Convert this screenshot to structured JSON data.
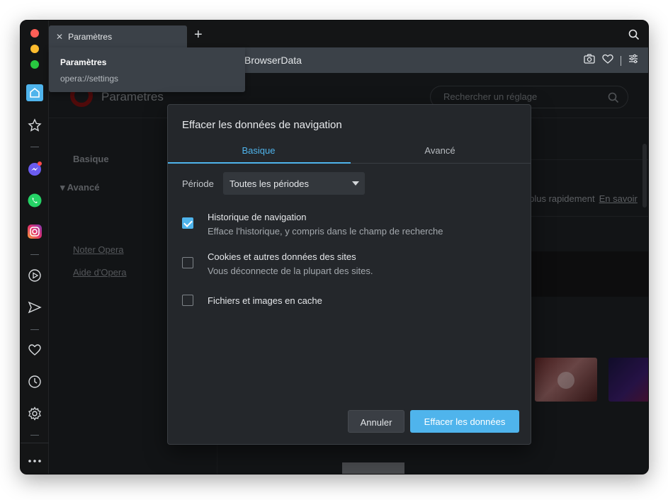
{
  "tab": {
    "label": "Paramètres"
  },
  "address": {
    "text": "BrowserData"
  },
  "tooltip": {
    "title": "Paramètres",
    "url": "opera://settings"
  },
  "settings_page": {
    "title": "Parametres",
    "search_placeholder": "Rechercher un réglage",
    "nav": {
      "basique": "Basique",
      "avance": "Avancé",
      "rate": "Noter Opera",
      "help": "Aide d'Opera"
    },
    "content_text": "s plus rapidement",
    "content_link": "En savoir"
  },
  "dialog": {
    "title": "Effacer les données de navigation",
    "tabs": [
      "Basique",
      "Avancé"
    ],
    "periode_label": "Période",
    "periode_value": "Toutes les périodes",
    "options": [
      {
        "title": "Historique de navigation",
        "subtitle": "Efface l'historique, y compris dans le champ de recherche",
        "checked": true
      },
      {
        "title": "Cookies et autres données des sites",
        "subtitle": "Vous déconnecte de la plupart des sites.",
        "checked": false
      },
      {
        "title": "Fichiers et images en cache",
        "subtitle": "",
        "checked": false
      }
    ],
    "cancel": "Annuler",
    "confirm": "Effacer les données"
  },
  "sidebar_icons": [
    "home-icon",
    "star-icon",
    "messenger-icon",
    "whatsapp-icon",
    "instagram-icon",
    "player-icon",
    "send-icon",
    "heart-icon",
    "clock-icon",
    "gear-icon",
    "more-icon"
  ],
  "colors": {
    "accent": "#4fb4ec",
    "dialog_bg": "#24272b",
    "window_bg": "#141516"
  }
}
